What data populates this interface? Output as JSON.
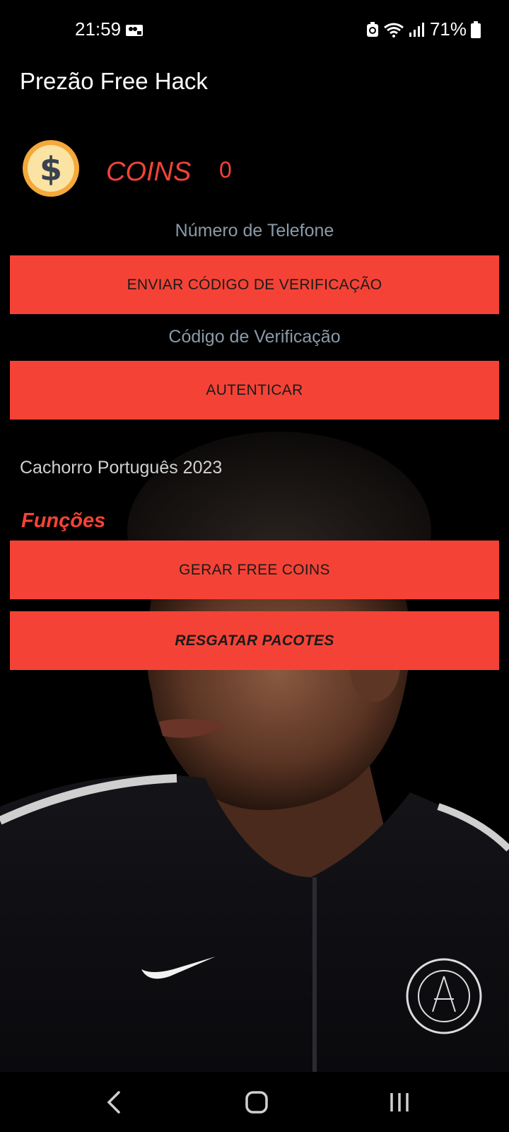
{
  "status_bar": {
    "time": "21:59",
    "battery": "71%",
    "icons": [
      "notification-icon",
      "battery-saver-icon",
      "wifi-icon",
      "signal-icon",
      "battery-icon"
    ]
  },
  "app": {
    "title": "Prezão Free Hack"
  },
  "coins": {
    "label": "COINS",
    "value": "0",
    "icon": "dollar-coin-icon"
  },
  "auth": {
    "phone_label": "Número de Telefone",
    "send_code_button": "ENVIAR CÓDIGO DE VERIFICAÇÃO",
    "code_label": "Código de Verificação",
    "authenticate_button": "AUTENTICAR"
  },
  "credit": "Cachorro Português 2023",
  "functions": {
    "title": "Funções",
    "generate_button": "GERAR FREE COINS",
    "redeem_button": "RESGATAR PACOTES"
  },
  "nav": {
    "icons": [
      "back-icon",
      "home-icon",
      "recent-apps-icon"
    ]
  },
  "colors": {
    "accent": "#f44336",
    "background": "#000000",
    "label_gray": "#8a9aa8"
  }
}
